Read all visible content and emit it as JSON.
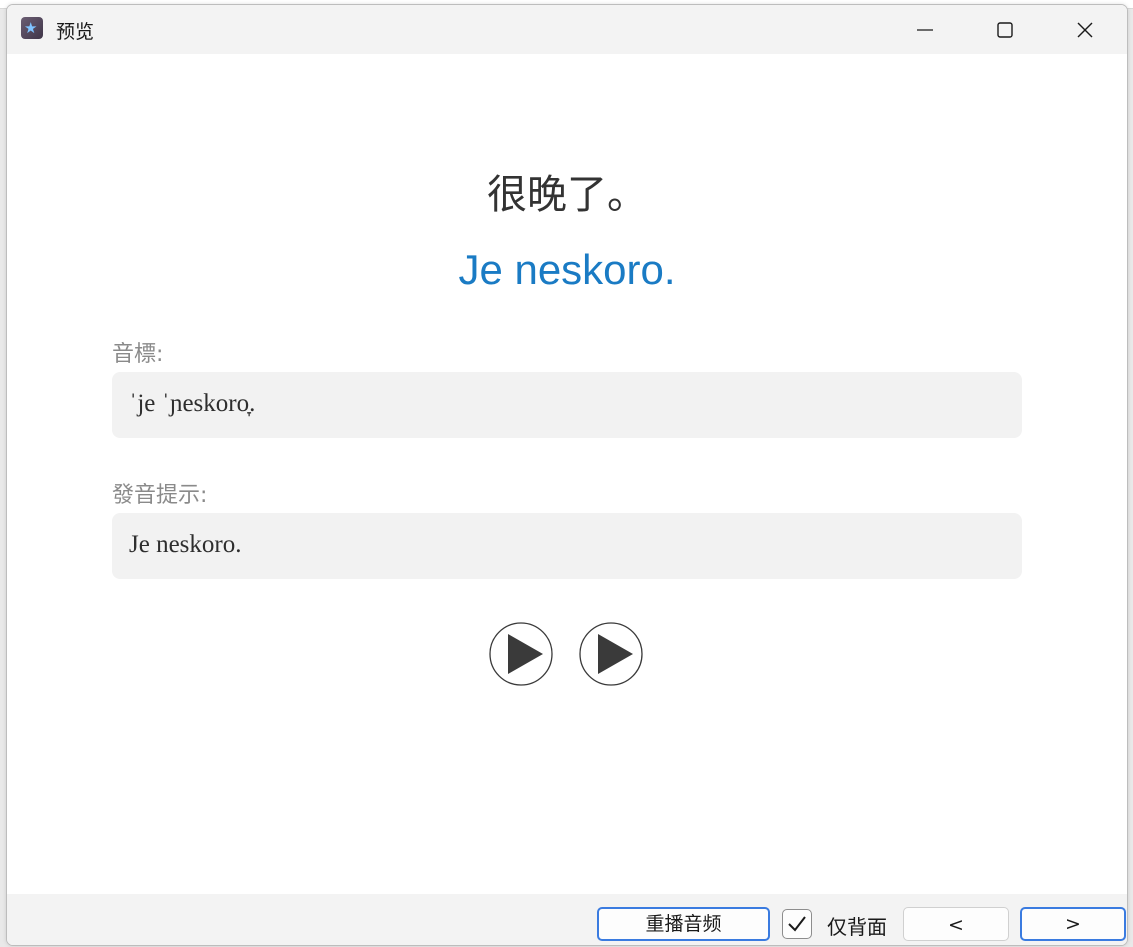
{
  "window": {
    "title": "预览"
  },
  "card": {
    "front": "很晚了。",
    "back": "Je neskoro.",
    "fields": [
      {
        "label": "音標:",
        "value": "ˈje ˈɲeskoro̞."
      },
      {
        "label": "發音提示:",
        "value": "Je neskoro."
      }
    ],
    "audio_buttons": 2
  },
  "footer": {
    "replay_label": "重播音频",
    "back_only_label": "仅背面",
    "back_only_checked": true,
    "prev_label": "<",
    "next_label": ">"
  },
  "colors": {
    "accent": "#3a7be0",
    "back_text": "#1a7bc4",
    "label": "#8a8a8a",
    "field_bg": "#f2f2f2"
  }
}
